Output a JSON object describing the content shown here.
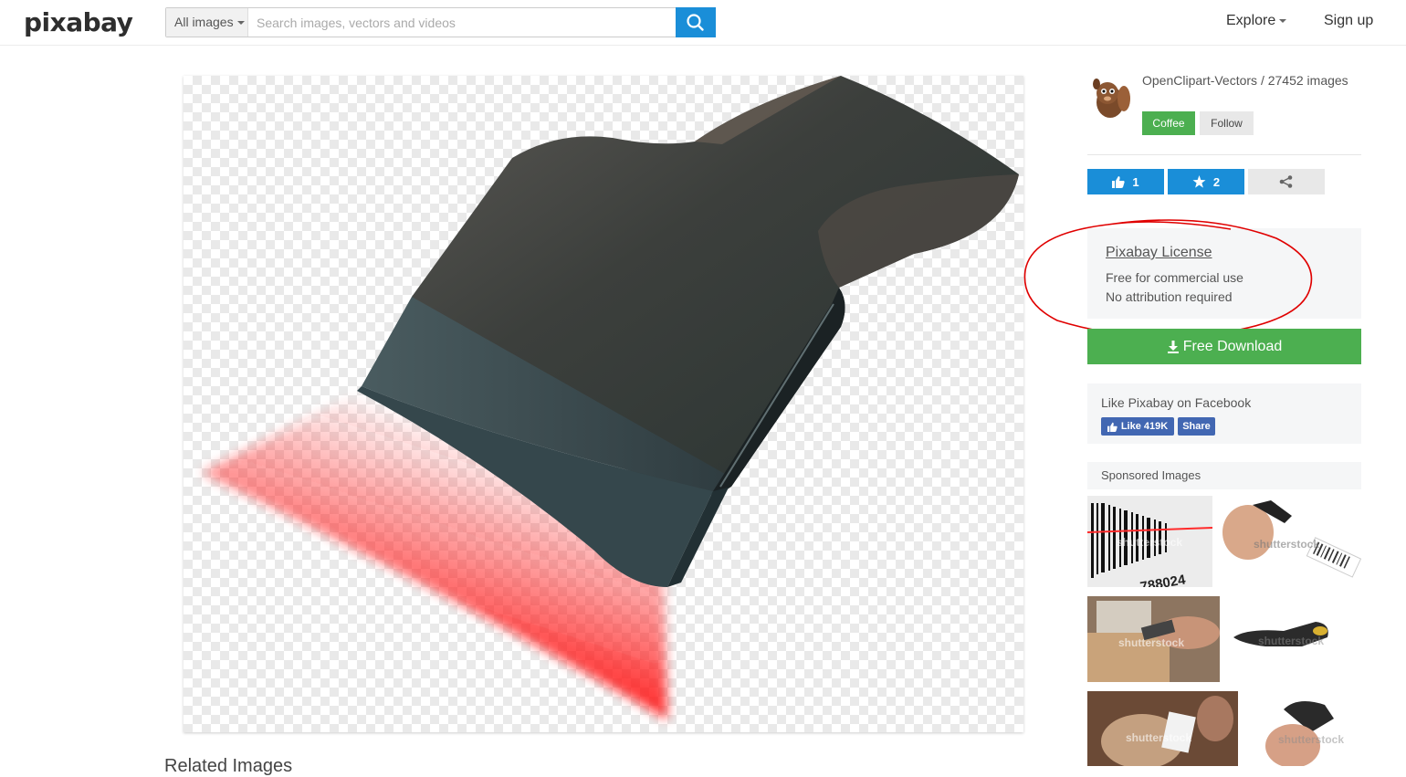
{
  "header": {
    "logo": "pixabay",
    "search_type": "All images",
    "search_placeholder": "Search images, vectors and videos",
    "nav_explore": "Explore",
    "nav_signup": "Sign up"
  },
  "author": {
    "name": "OpenClipart-Vectors / 27452 images",
    "coffee_label": "Coffee",
    "follow_label": "Follow"
  },
  "stats": {
    "likes": "1",
    "favorites": "2"
  },
  "license": {
    "title": "Pixabay License",
    "line1": "Free for commercial use",
    "line2": "No attribution required"
  },
  "download": {
    "label": "Free Download"
  },
  "facebook": {
    "text": "Like Pixabay on Facebook",
    "like_label": "Like 419K",
    "share_label": "Share"
  },
  "sponsored": {
    "heading": "Sponsored Images",
    "watermark": "shutterstock",
    "barcode_number": "788024"
  },
  "related": {
    "heading": "Related Images"
  },
  "colors": {
    "accent_blue": "#1a8ed8",
    "green": "#4caf50",
    "facebook_blue": "#4267b2",
    "annotation_red": "#e00000"
  }
}
